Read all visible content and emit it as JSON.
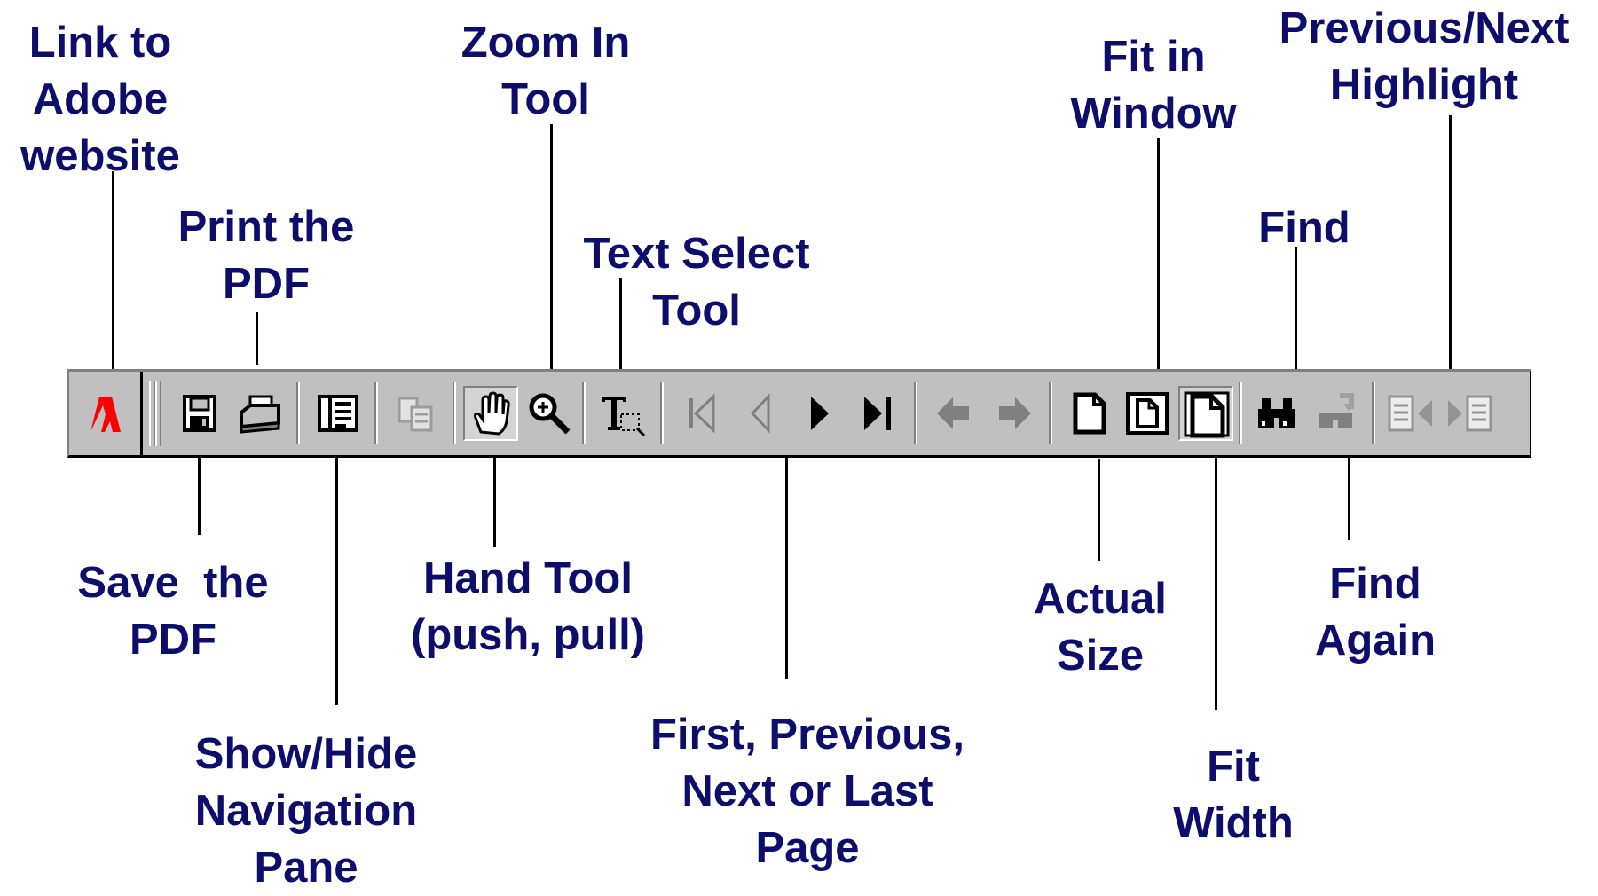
{
  "labels": {
    "adobe_link": "Link to\nAdobe\nwebsite",
    "print": "Print the\nPDF",
    "zoom_in": "Zoom In\nTool",
    "text_select": "Text Select\nTool",
    "fit_window": "Fit in\nWindow",
    "prev_next_highlight": "Previous/Next\nHighlight",
    "find": "Find",
    "save": "Save  the\nPDF",
    "hand_tool": "Hand Tool\n(push, pull)",
    "show_hide_nav": "Show/Hide\nNavigation\nPane",
    "page_nav": "First, Previous,\nNext or Last\nPage",
    "actual_size": "Actual\nSize",
    "fit_width": "Fit\nWidth",
    "find_again": "Find\nAgain"
  },
  "icons": [
    "adobe-logo-icon",
    "save-icon",
    "print-icon",
    "navigation-pane-icon",
    "copy-icon",
    "hand-icon",
    "zoom-in-icon",
    "text-select-icon",
    "first-page-icon",
    "previous-page-icon",
    "next-page-icon",
    "last-page-icon",
    "go-back-icon",
    "go-forward-icon",
    "actual-size-icon",
    "fit-in-window-icon",
    "fit-width-icon",
    "find-icon",
    "find-again-icon",
    "previous-highlight-icon",
    "next-highlight-icon"
  ],
  "colors": {
    "label_text": "#0d0d6b",
    "toolbar_face": "#c0c0c0",
    "adobe_red": "#ff0000",
    "disabled_icon": "#808080"
  }
}
